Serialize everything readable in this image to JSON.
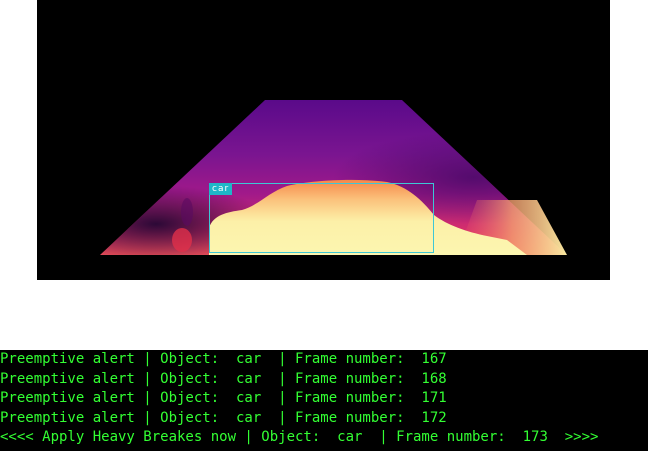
{
  "video": {
    "detection_label": "car"
  },
  "console": {
    "lines": [
      "Preemptive alert | Object:  car  | Frame number:  167",
      "Preemptive alert | Object:  car  | Frame number:  168",
      "Preemptive alert | Object:  car  | Frame number:  171",
      "Preemptive alert | Object:  car  | Frame number:  172",
      "<<<< Apply Heavy Breakes now | Object:  car  | Frame number:  173  >>>>"
    ]
  },
  "colors": {
    "console_text": "#33ff33",
    "detection_box": "#3ec7d6"
  }
}
